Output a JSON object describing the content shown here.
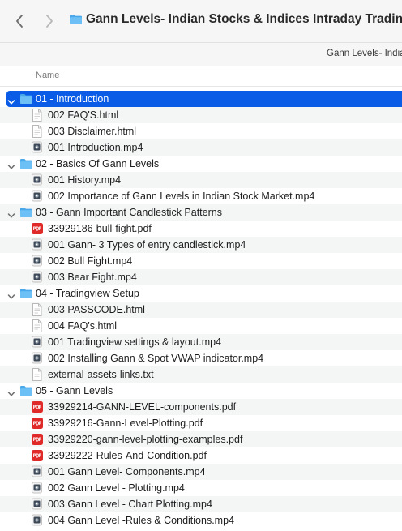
{
  "window": {
    "title": "Gann Levels- Indian Stocks & Indices Intraday Trading [",
    "path_label": "Gann Levels- India",
    "colors": {
      "selection": "#0a5ce6",
      "folder": "#5fb5f1",
      "pdf": "#e02a2a"
    }
  },
  "toolbar": {
    "back_icon": "chevron-left-icon",
    "forward_icon": "chevron-right-icon"
  },
  "columns": {
    "name": "Name"
  },
  "rows": [
    {
      "type": "folder",
      "label": "01 - Introduction",
      "selected": true
    },
    {
      "type": "html",
      "label": "002 FAQ'S.html"
    },
    {
      "type": "html",
      "label": "003 Disclaimer.html"
    },
    {
      "type": "video",
      "label": "001 Introduction.mp4"
    },
    {
      "type": "folder",
      "label": "02 - Basics Of Gann Levels"
    },
    {
      "type": "video",
      "label": "001 History.mp4"
    },
    {
      "type": "video",
      "label": "002 Importance of Gann Levels in Indian Stock Market.mp4"
    },
    {
      "type": "folder",
      "label": "03 - Gann Important Candlestick Patterns"
    },
    {
      "type": "pdf",
      "label": "33929186-bull-fight.pdf"
    },
    {
      "type": "video",
      "label": "001 Gann- 3 Types of entry candlestick.mp4"
    },
    {
      "type": "video",
      "label": "002 Bull Fight.mp4"
    },
    {
      "type": "video",
      "label": "003 Bear Fight.mp4"
    },
    {
      "type": "folder",
      "label": "04 - Tradingview Setup"
    },
    {
      "type": "html",
      "label": "003 PASSCODE.html"
    },
    {
      "type": "html",
      "label": "004 FAQ's.html"
    },
    {
      "type": "video",
      "label": "001 Tradingview settings & layout.mp4"
    },
    {
      "type": "video",
      "label": "002 Installing Gann & Spot VWAP indicator.mp4"
    },
    {
      "type": "txt",
      "label": "external-assets-links.txt"
    },
    {
      "type": "folder",
      "label": "05 - Gann Levels"
    },
    {
      "type": "pdf",
      "label": "33929214-GANN-LEVEL-components.pdf"
    },
    {
      "type": "pdf",
      "label": "33929216-Gann-Level-Plotting.pdf"
    },
    {
      "type": "pdf",
      "label": "33929220-gann-level-plotting-examples.pdf"
    },
    {
      "type": "pdf",
      "label": "33929222-Rules-And-Condition.pdf"
    },
    {
      "type": "video",
      "label": "001 Gann Level- Components.mp4"
    },
    {
      "type": "video",
      "label": "002 Gann Level - Plotting.mp4"
    },
    {
      "type": "video",
      "label": "003 Gann Level - Chart Plotting.mp4"
    },
    {
      "type": "video",
      "label": "004 Gann Level -Rules & Conditions.mp4"
    }
  ]
}
